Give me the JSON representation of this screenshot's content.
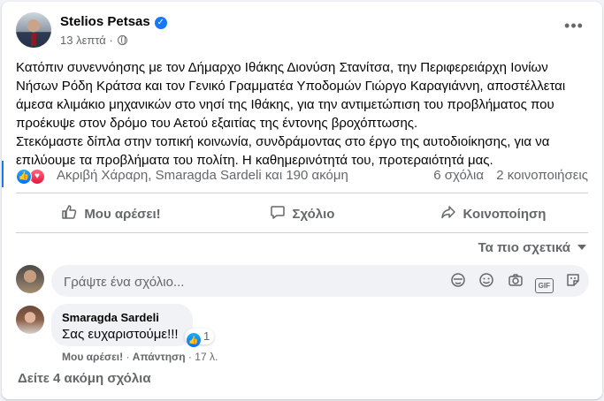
{
  "post": {
    "author": "Stelios Petsas",
    "time": "13 λεπτά",
    "separator": "·",
    "text_p1": "Κατόπιν συνεννόησης με τον Δήμαρχο Ιθάκης Διονύση Στανίτσα, την Περιφερειάρχη Ιονίων Νήσων Ρόδη Κράτσα και τον Γενικό Γραμματέα Υποδομών Γιώργο Καραγιάννη, αποστέλλεται άμεσα κλιμάκιο μηχανικών στο νησί της Ιθάκης, για την αντιμετώπιση του προβλήματος που προέκυψε στον δρόμο του Αετού εξαιτίας της έντονης βροχόπτωσης.",
    "text_p2": "Στεκόμαστε δίπλα στην τοπική κοινωνία, συνδράμοντας στο έργο της αυτοδιοίκησης, για να επιλύουμε τα προβλήματα του πολίτη. Η καθημερινότητά του, προτεραιότητά μας."
  },
  "reactions": {
    "names": "Ακριβή Χάραρη, Smaragda Sardeli και 190 ακόμη",
    "comments": "6 σχόλια",
    "shares": "2 κοινοποιήσεις"
  },
  "actions": {
    "like": "Μου αρέσει!",
    "comment": "Σχόλιο",
    "share": "Κοινοποίηση"
  },
  "sort": {
    "label": "Τα πιο σχετικά"
  },
  "composer": {
    "placeholder": "Γράψτε ένα σχόλιο..."
  },
  "comment": {
    "author": "Smaragda Sardeli",
    "text": "Σας ευχαριστούμε!!!",
    "reaction_count": "1",
    "like_label": "Μου αρέσει!",
    "reply_label": "Απάντηση",
    "time": "17 λ.",
    "dot": "·"
  },
  "more_comments": "Δείτε 4 ακόμη σχόλια",
  "colors": {
    "accent": "#1877f2",
    "secondary_text": "#65676b",
    "background": "#f0f2f5"
  }
}
